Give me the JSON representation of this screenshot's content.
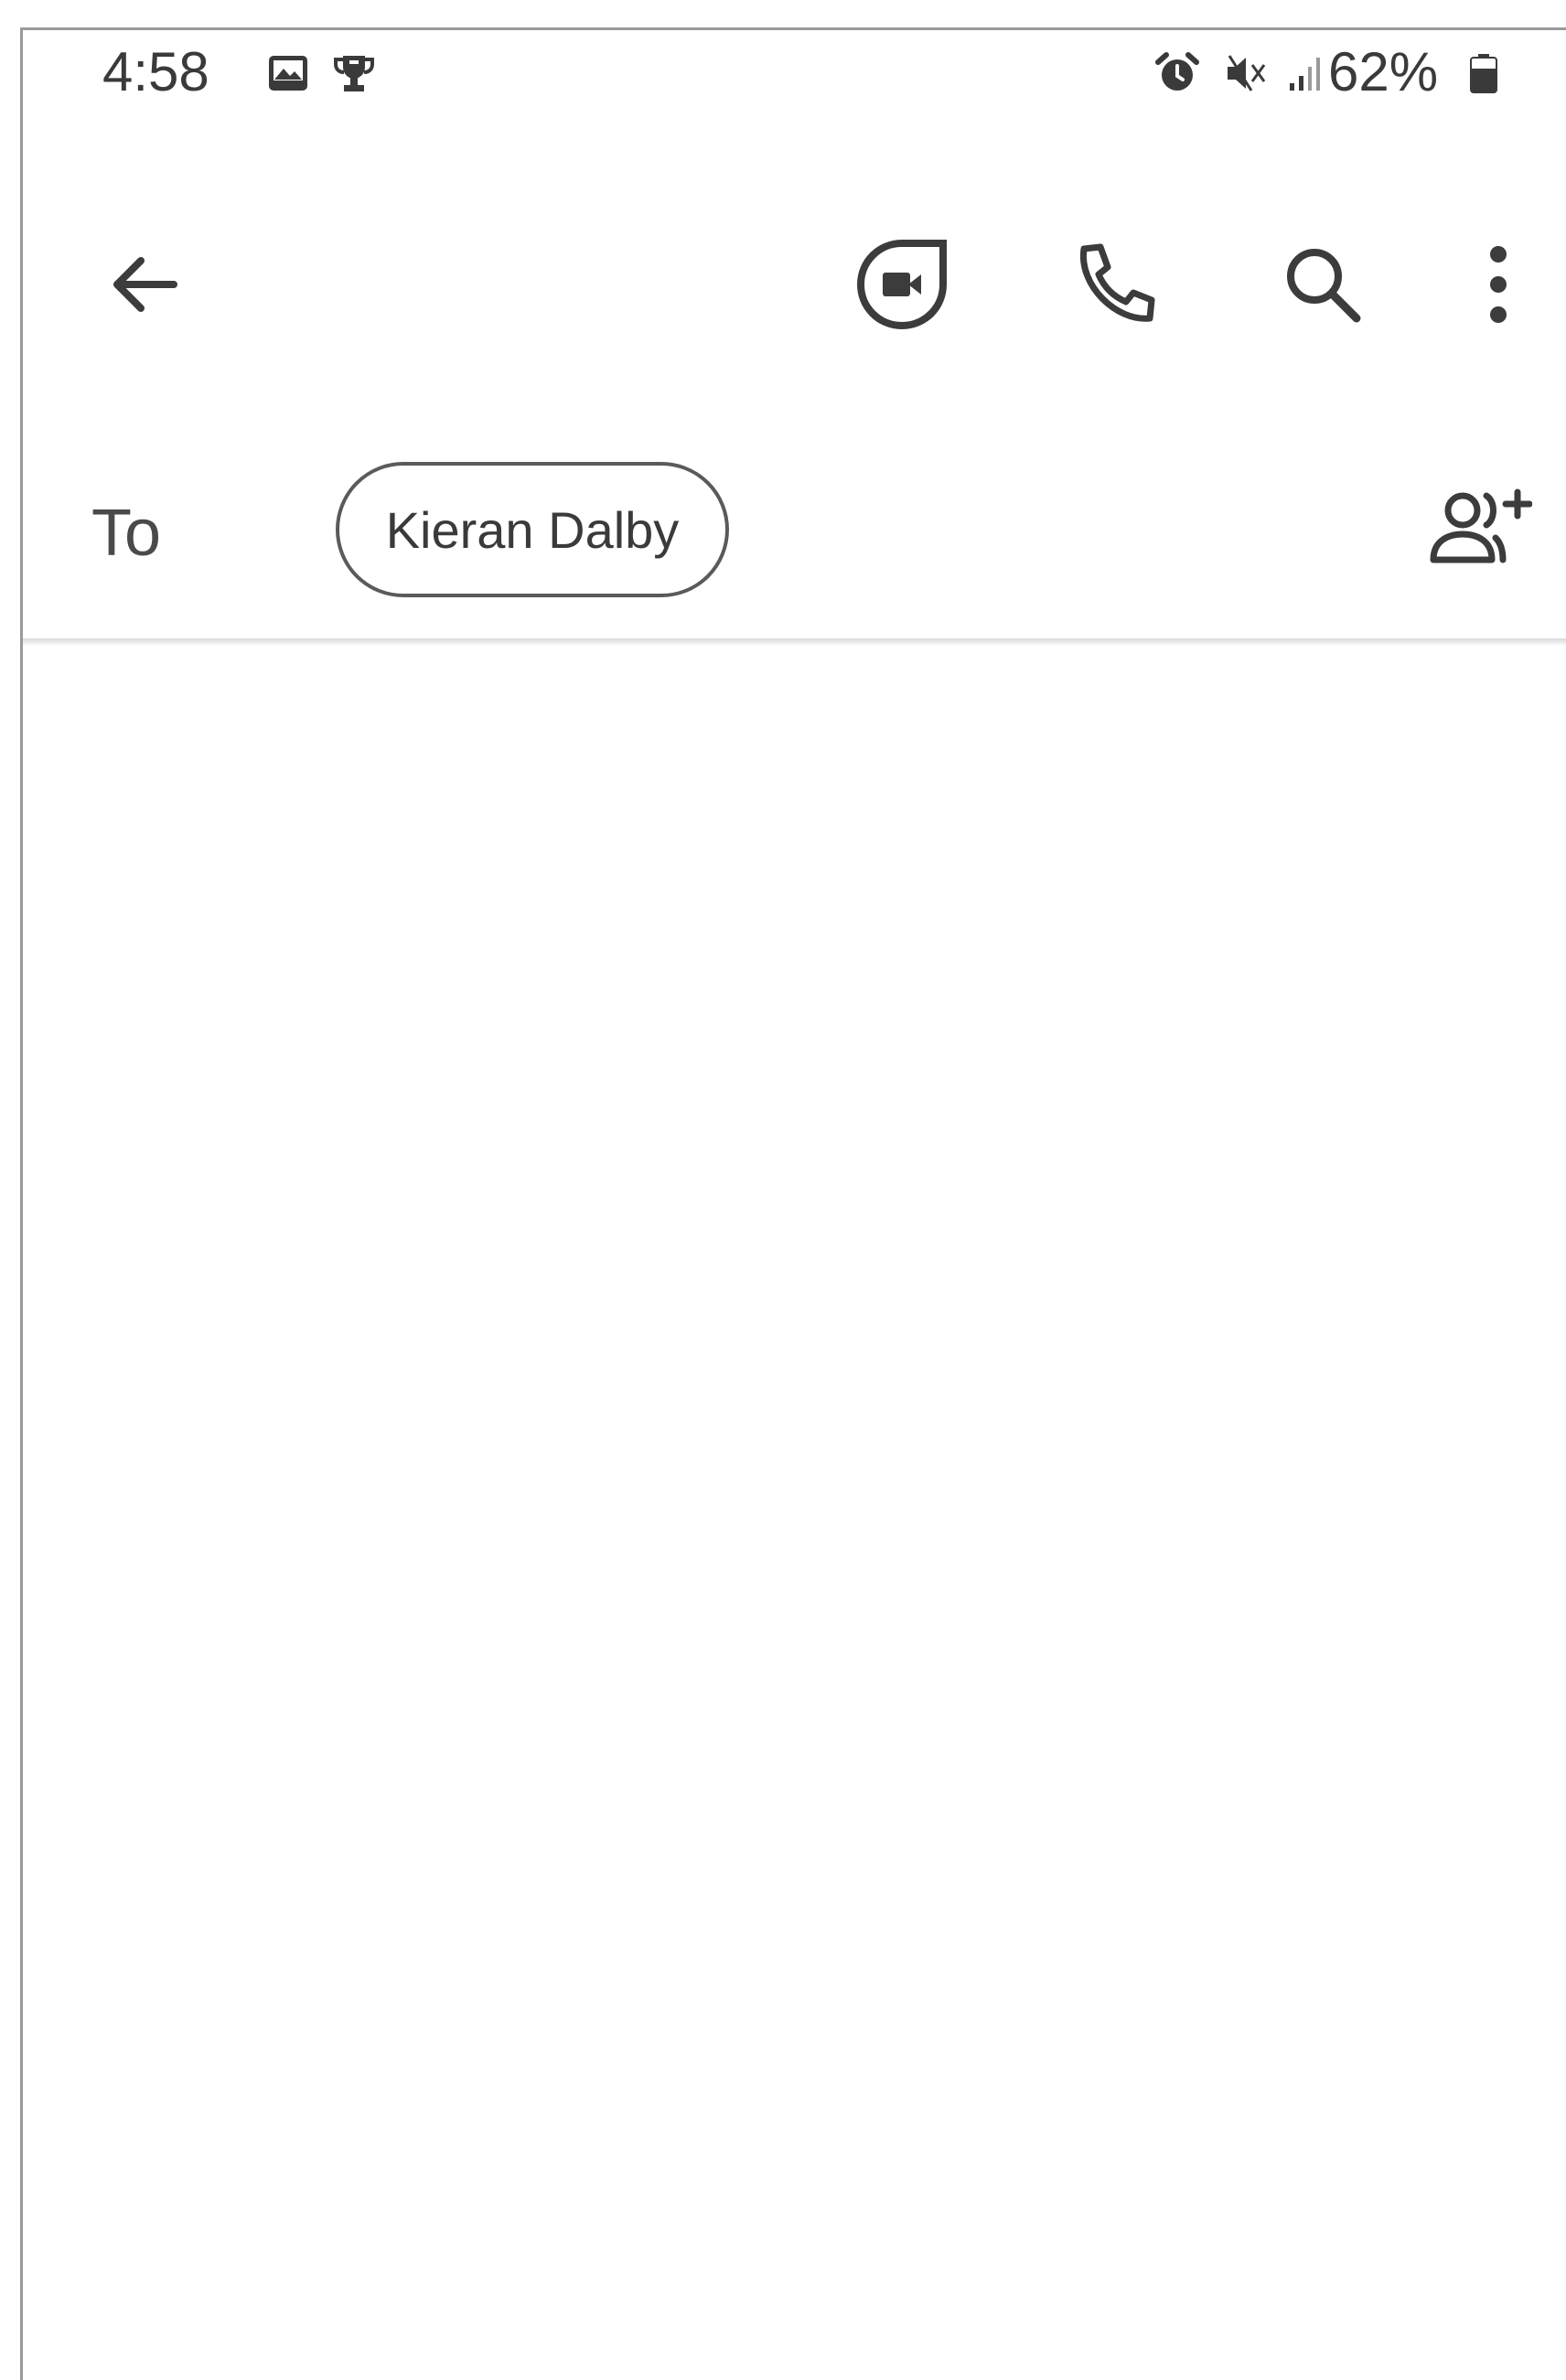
{
  "status_bar": {
    "time": "4:58",
    "left_icons": [
      "gallery-icon",
      "trophy-icon"
    ],
    "right_icons": [
      "alarm-icon",
      "mute-icon",
      "signal-icon"
    ],
    "battery_percent_label": "62%",
    "battery_icon": "battery-icon"
  },
  "toolbar": {
    "back_icon": "arrow-back-icon",
    "actions": [
      {
        "name": "video-call",
        "icon": "video-call-icon"
      },
      {
        "name": "voice-call",
        "icon": "phone-icon"
      },
      {
        "name": "search",
        "icon": "search-icon"
      },
      {
        "name": "more-options",
        "icon": "more-vert-icon"
      }
    ]
  },
  "recipients": {
    "to_label": "To",
    "chips": [
      {
        "label": "Kieran Dalby"
      }
    ],
    "add_icon": "add-person-icon"
  },
  "colors": {
    "icon": "#3c3c3c",
    "text": "#3a3a3a",
    "background": "#ffffff",
    "chip_border": "#5a5a5a",
    "divider": "#d9d9d9"
  }
}
